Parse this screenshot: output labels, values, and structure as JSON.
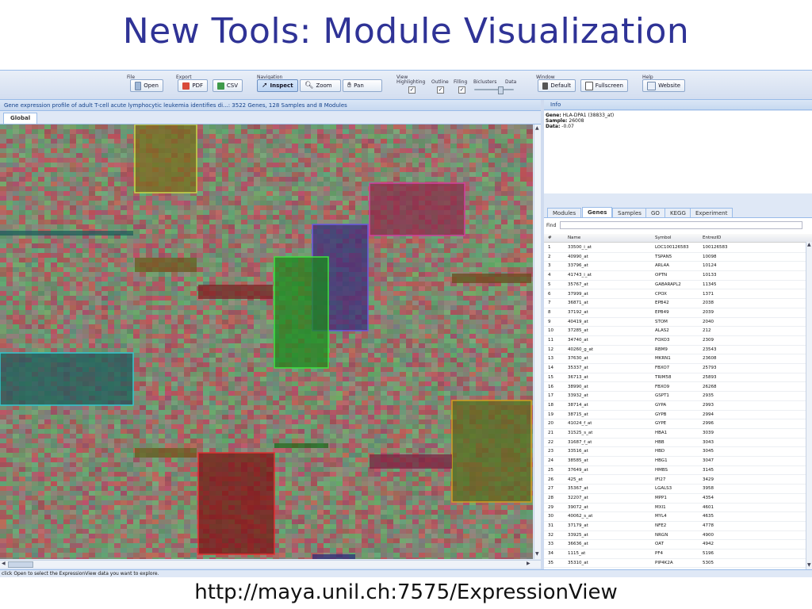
{
  "slide": {
    "title": "New Tools: Module Visualization",
    "url": "http://maya.unil.ch:7575/ExpressionView"
  },
  "toolbar": {
    "file": {
      "title": "File",
      "open_label": "Open"
    },
    "export": {
      "title": "Export",
      "pdf_label": "PDF",
      "csv_label": "CSV"
    },
    "navigation": {
      "title": "Navigation",
      "inspect_label": "Inspect",
      "zoom_label": "Zoom",
      "pan_label": "Pan",
      "active": "Inspect"
    },
    "view": {
      "title": "View",
      "highlighting_label": "Highlighting",
      "outline_label": "Outline",
      "filling_label": "Filling",
      "biclusters_label": "Biclusters",
      "data_label": "Data",
      "highlighting": true,
      "outline": true,
      "filling": true
    },
    "window": {
      "title": "Window",
      "default_label": "Default",
      "fullscreen_label": "Fullscreen"
    },
    "help": {
      "title": "Help",
      "website_label": "Website"
    }
  },
  "main": {
    "title": "Gene expression profile of adult T-cell acute lymphocytic leukemia identifies di...: 3522 Genes, 128 Samples and 8 Modules",
    "tab": "Global",
    "colors": {
      "background_green": "#6a9a6e",
      "background_red": "#a25a60"
    }
  },
  "info": {
    "title": "Info",
    "gene_label": "Gene:",
    "gene": "HLA-DPA1 (38833_at)",
    "sample_label": "Sample:",
    "sample": "26008",
    "data_label": "Data:",
    "data": "-0.07"
  },
  "tabs": [
    "Modules",
    "Genes",
    "Samples",
    "GO",
    "KEGG",
    "Experiment"
  ],
  "active_tab": "Genes",
  "find_label": "Find",
  "genes_table": {
    "columns": [
      "#",
      "Name",
      "Symbol",
      "EntrezID"
    ],
    "rows": [
      [
        "1",
        "33500_i_at",
        "LOC100126583",
        "100126583"
      ],
      [
        "2",
        "40990_at",
        "TSPAN5",
        "10098"
      ],
      [
        "3",
        "33796_at",
        "ARL4A",
        "10124"
      ],
      [
        "4",
        "41743_i_at",
        "OPTN",
        "10133"
      ],
      [
        "5",
        "35767_at",
        "GABARAPL2",
        "11345"
      ],
      [
        "6",
        "37999_at",
        "CPOX",
        "1371"
      ],
      [
        "7",
        "36871_at",
        "EPB42",
        "2038"
      ],
      [
        "8",
        "37192_at",
        "EPB49",
        "2039"
      ],
      [
        "9",
        "40419_at",
        "STOM",
        "2040"
      ],
      [
        "10",
        "37285_at",
        "ALAS2",
        "212"
      ],
      [
        "11",
        "34740_at",
        "FOXO3",
        "2309"
      ],
      [
        "12",
        "40260_g_at",
        "RBM9",
        "23543"
      ],
      [
        "13",
        "37630_at",
        "MKRN1",
        "23608"
      ],
      [
        "14",
        "35337_at",
        "FBXO7",
        "25793"
      ],
      [
        "15",
        "36713_at",
        "TRIM58",
        "25893"
      ],
      [
        "16",
        "38990_at",
        "FBXO9",
        "26268"
      ],
      [
        "17",
        "33932_at",
        "GSPT1",
        "2935"
      ],
      [
        "18",
        "38714_at",
        "GYPA",
        "2993"
      ],
      [
        "19",
        "38715_at",
        "GYPB",
        "2994"
      ],
      [
        "20",
        "41024_f_at",
        "GYPE",
        "2996"
      ],
      [
        "21",
        "31525_s_at",
        "HBA1",
        "3039"
      ],
      [
        "22",
        "31687_f_at",
        "HBB",
        "3043"
      ],
      [
        "23",
        "33516_at",
        "HBD",
        "3045"
      ],
      [
        "24",
        "38585_at",
        "HBG1",
        "3047"
      ],
      [
        "25",
        "37649_at",
        "HMBS",
        "3145"
      ],
      [
        "26",
        "425_at",
        "IFI27",
        "3429"
      ],
      [
        "27",
        "35367_at",
        "LGALS3",
        "3958"
      ],
      [
        "28",
        "32207_at",
        "MPP1",
        "4354"
      ],
      [
        "29",
        "39072_at",
        "MXI1",
        "4601"
      ],
      [
        "30",
        "40062_s_at",
        "MYL4",
        "4635"
      ],
      [
        "31",
        "37179_at",
        "NFE2",
        "4778"
      ],
      [
        "32",
        "33925_at",
        "NRGN",
        "4900"
      ],
      [
        "33",
        "36636_at",
        "OAT",
        "4942"
      ],
      [
        "34",
        "1115_at",
        "PF4",
        "5196"
      ],
      [
        "35",
        "35310_at",
        "PIP4K2A",
        "5305"
      ]
    ]
  },
  "status": "click Open to select the ExpressionView data you want to explore."
}
